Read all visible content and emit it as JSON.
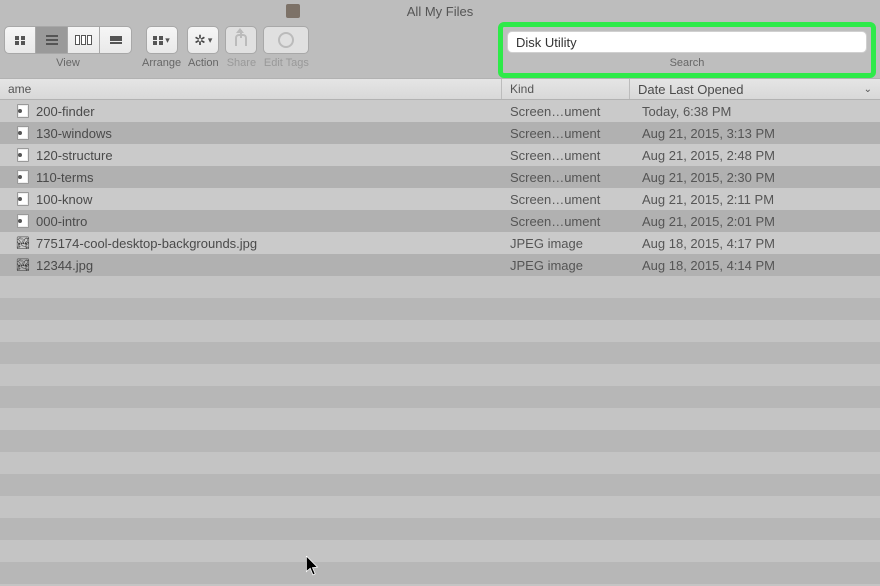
{
  "title": "All My Files",
  "toolbar": {
    "view_label": "View",
    "arrange_label": "Arrange",
    "action_label": "Action",
    "share_label": "Share",
    "edit_tags_label": "Edit Tags",
    "search_label": "Search"
  },
  "search": {
    "value": "Disk Utility"
  },
  "columns": {
    "name": "ame",
    "kind": "Kind",
    "date": "Date Last Opened"
  },
  "files": [
    {
      "icon": "doc",
      "name": "200-finder",
      "kind": "Screen…ument",
      "date": "Today, 6:38 PM"
    },
    {
      "icon": "doc",
      "name": "130-windows",
      "kind": "Screen…ument",
      "date": "Aug 21, 2015, 3:13 PM"
    },
    {
      "icon": "doc",
      "name": "120-structure",
      "kind": "Screen…ument",
      "date": "Aug 21, 2015, 2:48 PM"
    },
    {
      "icon": "doc",
      "name": "110-terms",
      "kind": "Screen…ument",
      "date": "Aug 21, 2015, 2:30 PM"
    },
    {
      "icon": "doc",
      "name": "100-know",
      "kind": "Screen…ument",
      "date": "Aug 21, 2015, 2:11 PM"
    },
    {
      "icon": "doc",
      "name": "000-intro",
      "kind": "Screen…ument",
      "date": "Aug 21, 2015, 2:01 PM"
    },
    {
      "icon": "jpg",
      "name": "775174-cool-desktop-backgrounds.jpg",
      "kind": "JPEG image",
      "date": "Aug 18, 2015, 4:17 PM"
    },
    {
      "icon": "jpg",
      "name": "12344.jpg",
      "kind": "JPEG image",
      "date": "Aug 18, 2015, 4:14 PM"
    }
  ]
}
